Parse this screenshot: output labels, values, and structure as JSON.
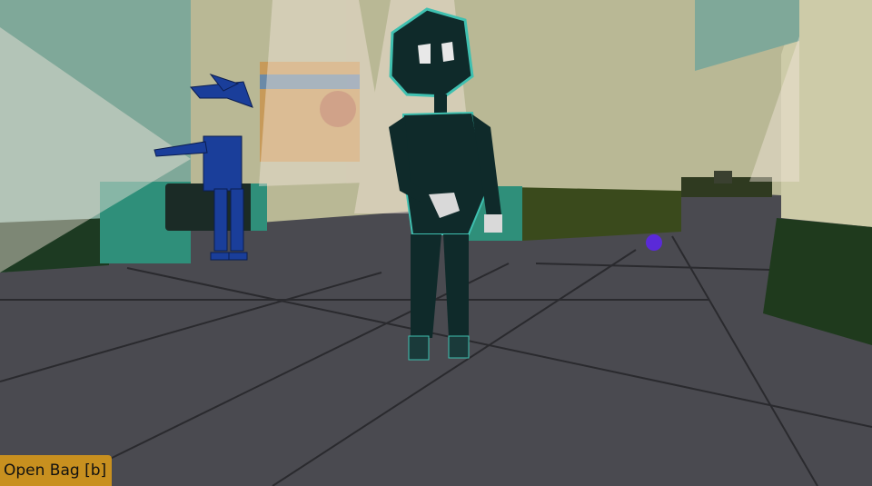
{
  "hud": {
    "open_bag_label": "Open Bag [b]"
  },
  "colors": {
    "floor": "#4a4a50",
    "wall_sage": "#a8aa8a",
    "wall_cream": "#c9c7a6",
    "wall_shadow": "#223322",
    "teal_trim": "#2f8f7a",
    "player": "#0f2a2a",
    "player_outline": "#3fc0b0",
    "npc_guard": "#1a3e9a",
    "spotlight": "#f2e6d8",
    "marker": "#5a2ad8",
    "button_bg": "#c8901f"
  }
}
